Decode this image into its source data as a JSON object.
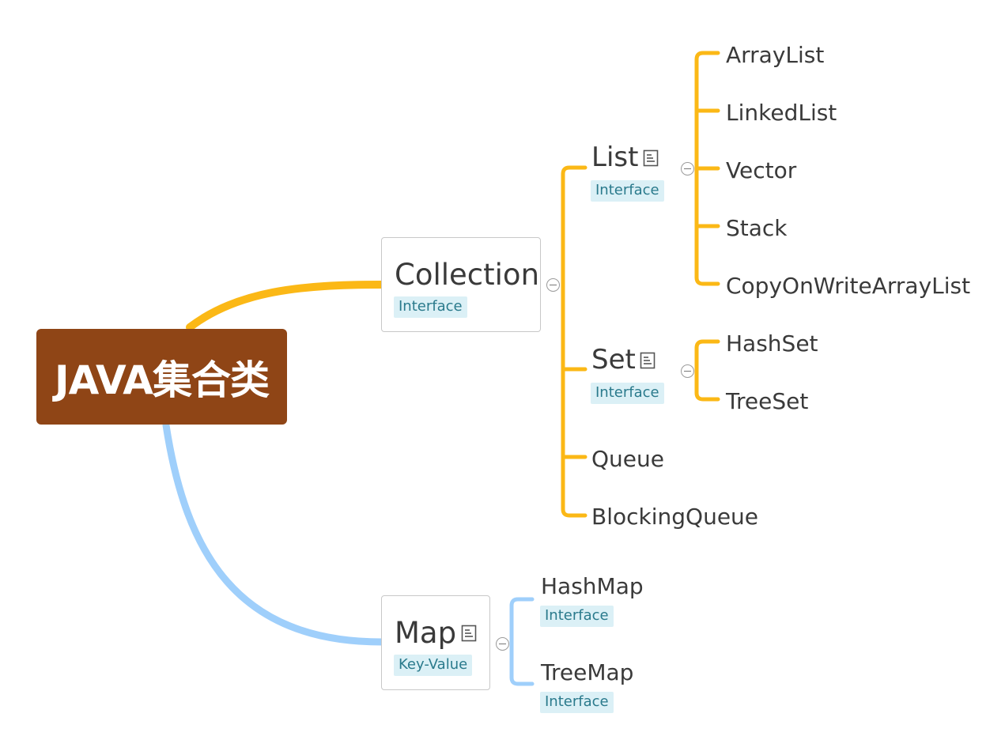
{
  "root": {
    "title": "JAVA集合类"
  },
  "collection": {
    "title": "Collection",
    "label": "Interface",
    "children": {
      "list": {
        "title": "List",
        "label": "Interface",
        "items": [
          "ArrayList",
          "LinkedList",
          "Vector",
          "Stack",
          "CopyOnWriteArrayList"
        ]
      },
      "set": {
        "title": "Set",
        "label": "Interface",
        "items": [
          "HashSet",
          "TreeSet"
        ]
      },
      "queue": {
        "title": "Queue"
      },
      "blocking_queue": {
        "title": "BlockingQueue"
      }
    }
  },
  "map": {
    "title": "Map",
    "label": "Key-Value",
    "children": [
      {
        "title": "HashMap",
        "label": "Interface"
      },
      {
        "title": "TreeMap",
        "label": "Interface"
      }
    ]
  },
  "colors": {
    "root_fill": "#8f4516",
    "collection_branch": "#fbb816",
    "map_branch": "#9fcffb",
    "label_fill": "#dbf0f6",
    "label_text": "#2a7a8c"
  }
}
